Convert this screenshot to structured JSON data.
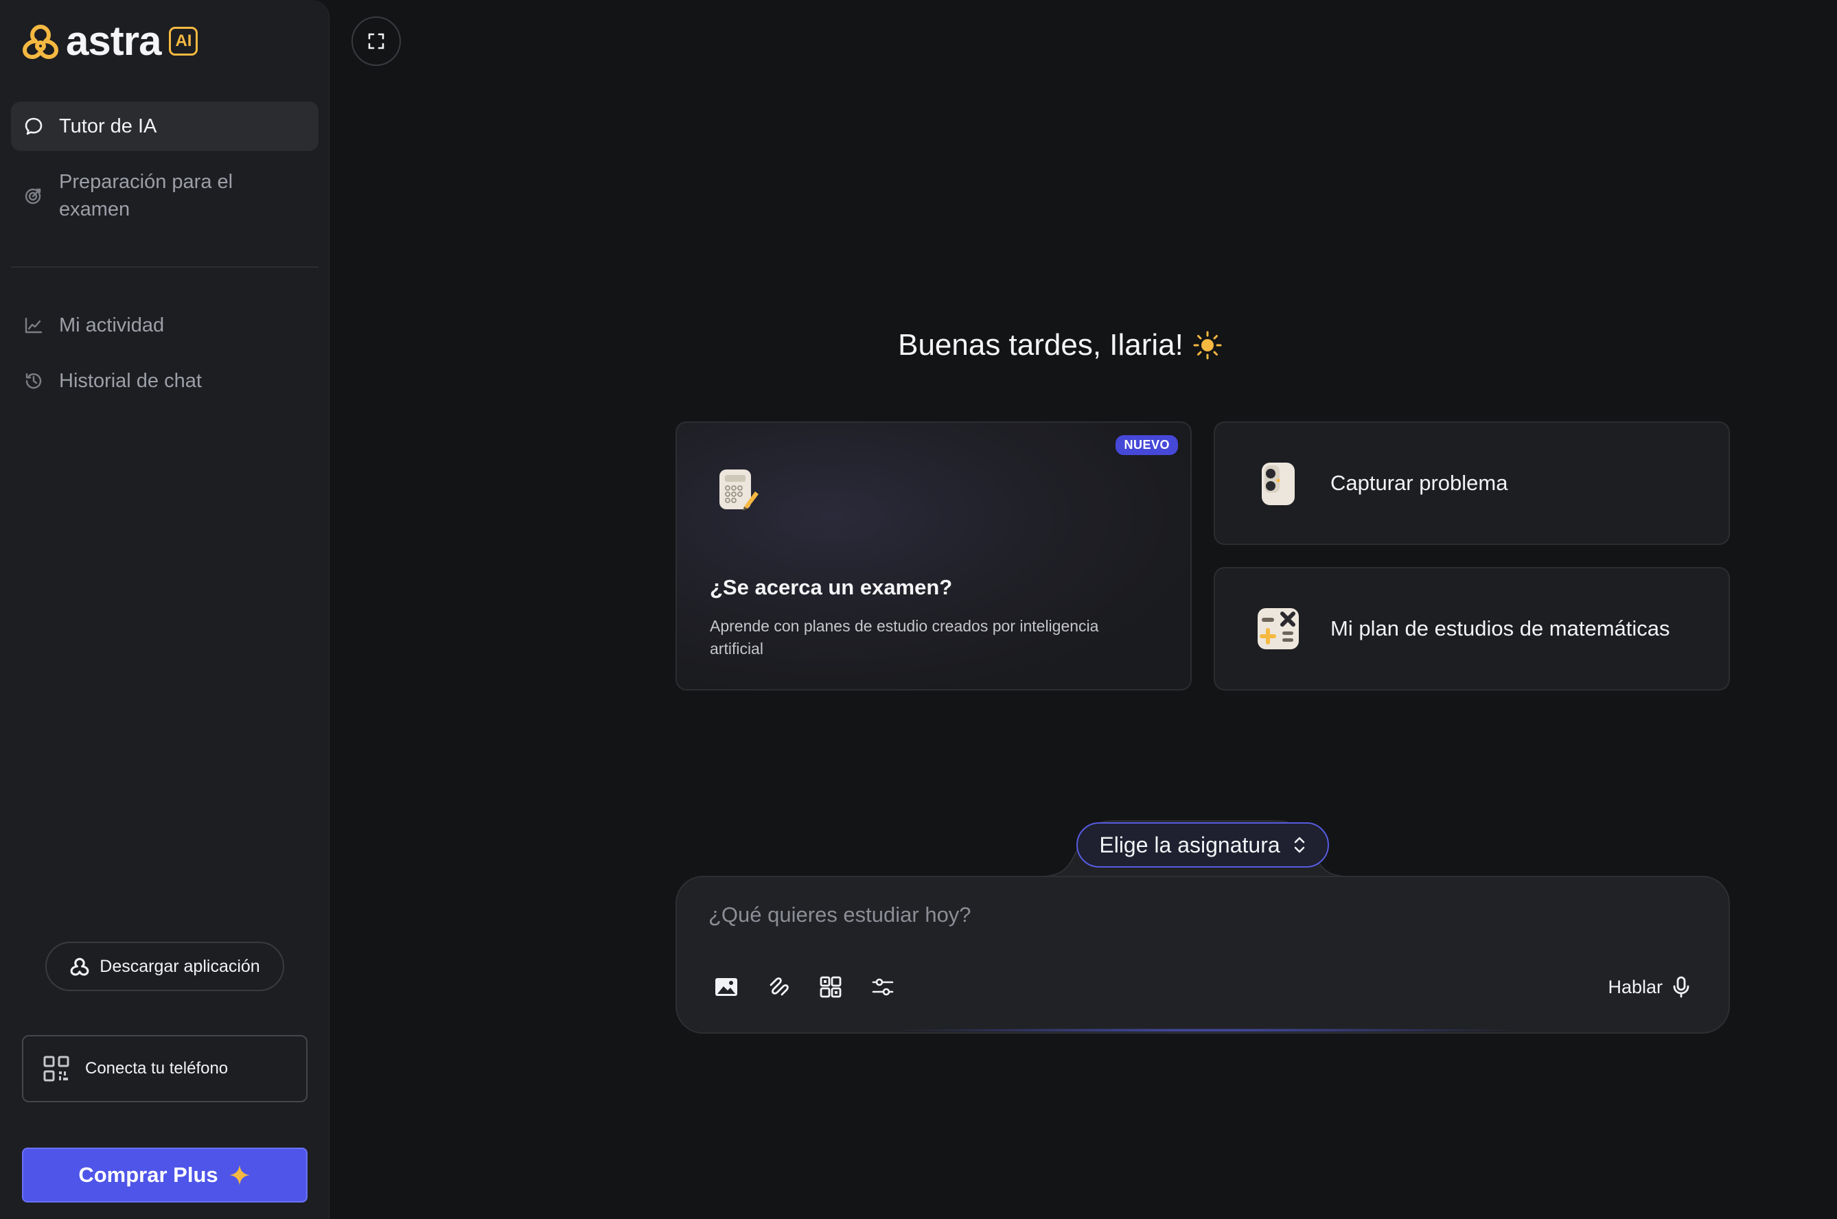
{
  "brand": {
    "name": "astra",
    "badge": "AI",
    "accent": "#f5b942"
  },
  "sidebar": {
    "items": [
      {
        "label": "Tutor de IA",
        "icon": "chat-bubble-icon",
        "active": true
      },
      {
        "label": "Preparación para el examen",
        "icon": "target-icon",
        "active": false
      },
      {
        "label": "Mi actividad",
        "icon": "activity-chart-icon",
        "active": false
      },
      {
        "label": "Historial de chat",
        "icon": "history-icon",
        "active": false
      }
    ],
    "download_label": "Descargar aplicación",
    "connect_phone_label": "Conecta tu teléfono",
    "buy_plus_label": "Comprar Plus",
    "buy_color": "#4e55e8"
  },
  "main": {
    "greeting": "Buenas tardes, Ilaria!",
    "cards": {
      "exam": {
        "badge": "NUEVO",
        "title": "¿Se acerca un examen?",
        "description": "Aprende con planes de estudio creados por inteligencia artificial"
      },
      "capture": {
        "label": "Capturar problema"
      },
      "plan": {
        "label": "Mi plan de estudios de matemáticas"
      }
    },
    "composer": {
      "subject_label": "Elige la asignatura",
      "placeholder": "¿Qué quieres estudiar hoy?",
      "talk_label": "Hablar"
    }
  }
}
